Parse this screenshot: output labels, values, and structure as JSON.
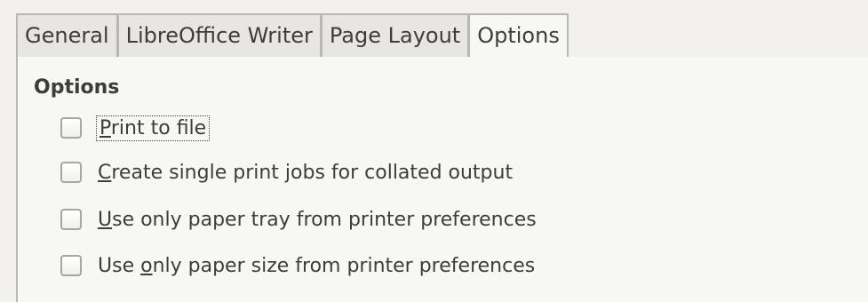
{
  "tabs": [
    {
      "label": "General",
      "active": false
    },
    {
      "label": "LibreOffice Writer",
      "active": false
    },
    {
      "label": "Page Layout",
      "active": false
    },
    {
      "label": "Options",
      "active": true
    }
  ],
  "section": {
    "title": "Options"
  },
  "options": [
    {
      "mnemonic": "P",
      "rest": "rint to file",
      "checked": false,
      "focused": true
    },
    {
      "mnemonic": "C",
      "rest": "reate single print jobs for collated output",
      "checked": false
    },
    {
      "mnemonic": "U",
      "rest": "se only paper tray from printer preferences",
      "checked": false
    },
    {
      "prefix": "Use ",
      "mnemonic": "o",
      "rest": "nly paper size from printer preferences",
      "checked": false
    }
  ],
  "colors": {
    "tab_border": "#b9b7b4",
    "panel_background": "#f7f7f6",
    "text": "#3c3c3c"
  }
}
